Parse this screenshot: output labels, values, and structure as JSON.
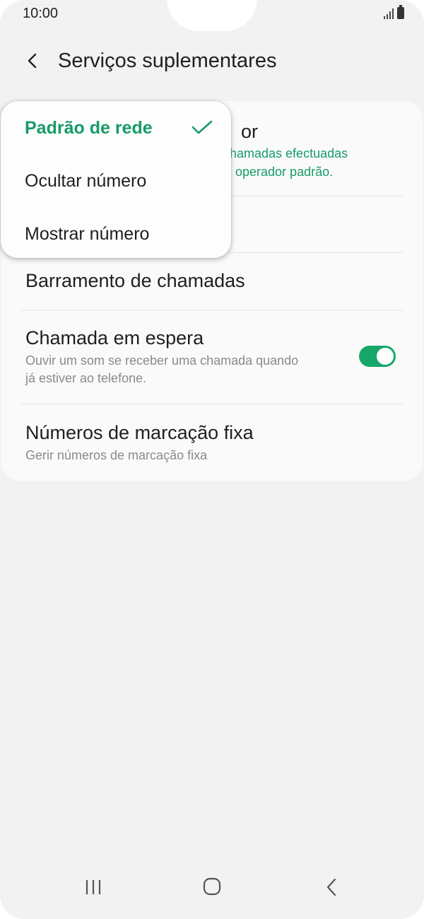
{
  "status_bar": {
    "time": "10:00"
  },
  "header": {
    "title": "Serviços suplementares",
    "back_icon": "chevron-left-icon"
  },
  "settings": {
    "caller_id": {
      "title_visible_fragment": "or",
      "subtitle_visible_line1": "hamadas efectuadas",
      "subtitle_visible_line2": "operador padrão."
    },
    "call_barring": {
      "title": "Barramento de chamadas"
    },
    "call_waiting": {
      "title": "Chamada em espera",
      "subtitle_line1": "Ouvir um som se receber uma chamada quando",
      "subtitle_line2": "já estiver ao telefone.",
      "toggle_on": true
    },
    "fixed_dialing": {
      "title": "Números de marcação fixa",
      "subtitle": "Gerir números de marcação fixa"
    }
  },
  "popup": {
    "options": [
      {
        "label": "Padrão de rede",
        "selected": true
      },
      {
        "label": "Ocultar número",
        "selected": false
      },
      {
        "label": "Mostrar número",
        "selected": false
      }
    ],
    "check_icon": "checkmark-icon"
  },
  "navbar": {
    "recents_icon": "recents-icon",
    "home_icon": "home-icon",
    "back_icon": "back-icon"
  },
  "colors": {
    "accent": "#179b68",
    "toggle_on": "#17a768",
    "background": "#f2f2f2",
    "card": "#fafafa"
  }
}
